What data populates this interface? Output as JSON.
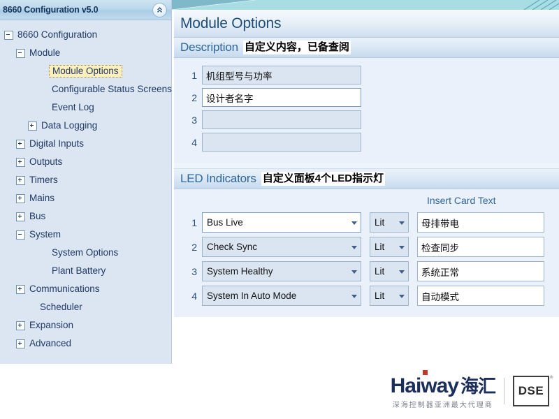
{
  "sidebar": {
    "title": "8660 Configuration v5.0",
    "collapse_icon": "chevron-double-up-icon",
    "tree": [
      {
        "label": "8660 Configuration",
        "indent": 0,
        "state": "expanded",
        "selected": false
      },
      {
        "label": "Module",
        "indent": 1,
        "state": "expanded",
        "selected": false
      },
      {
        "label": "Module Options",
        "indent": 3,
        "state": "leaf",
        "selected": true
      },
      {
        "label": "Configurable Status Screens",
        "indent": 3,
        "state": "leaf",
        "selected": false
      },
      {
        "label": "Event Log",
        "indent": 3,
        "state": "leaf",
        "selected": false
      },
      {
        "label": "Data Logging",
        "indent": 2,
        "state": "collapsed",
        "selected": false
      },
      {
        "label": "Digital Inputs",
        "indent": 1,
        "state": "collapsed",
        "selected": false
      },
      {
        "label": "Outputs",
        "indent": 1,
        "state": "collapsed",
        "selected": false
      },
      {
        "label": "Timers",
        "indent": 1,
        "state": "collapsed",
        "selected": false
      },
      {
        "label": "Mains",
        "indent": 1,
        "state": "collapsed",
        "selected": false
      },
      {
        "label": "Bus",
        "indent": 1,
        "state": "collapsed",
        "selected": false
      },
      {
        "label": "System",
        "indent": 1,
        "state": "expanded",
        "selected": false
      },
      {
        "label": "System Options",
        "indent": 3,
        "state": "leaf",
        "selected": false
      },
      {
        "label": "Plant Battery",
        "indent": 3,
        "state": "leaf",
        "selected": false
      },
      {
        "label": "Communications",
        "indent": 1,
        "state": "collapsed",
        "selected": false
      },
      {
        "label": "Scheduler",
        "indent": 2,
        "state": "leaf",
        "selected": false
      },
      {
        "label": "Expansion",
        "indent": 1,
        "state": "collapsed",
        "selected": false
      },
      {
        "label": "Advanced",
        "indent": 1,
        "state": "collapsed",
        "selected": false
      }
    ]
  },
  "page": {
    "title": "Module Options"
  },
  "description_section": {
    "title": "Description",
    "annotation": "自定义内容，已备查阅",
    "rows": [
      {
        "index": "1",
        "value": "机组型号与功率",
        "active": false
      },
      {
        "index": "2",
        "value": "设计者名字",
        "active": true
      },
      {
        "index": "3",
        "value": "",
        "active": false
      },
      {
        "index": "4",
        "value": "",
        "active": false
      }
    ]
  },
  "led_section": {
    "title": "LED Indicators",
    "annotation": "自定义面板4个LED指示灯",
    "card_text_header": "Insert Card Text",
    "rows": [
      {
        "index": "1",
        "source": "Bus Live",
        "mode": "Lit",
        "card_text": "母排带电",
        "active": true
      },
      {
        "index": "2",
        "source": "Check Sync",
        "mode": "Lit",
        "card_text": "检查同步",
        "active": false
      },
      {
        "index": "3",
        "source": "System Healthy",
        "mode": "Lit",
        "card_text": "系统正常",
        "active": false
      },
      {
        "index": "4",
        "source": "System In Auto Mode",
        "mode": "Lit",
        "card_text": "自动模式",
        "active": false
      }
    ]
  },
  "brand": {
    "name_en": "Haiway",
    "name_cn": "海汇",
    "tagline": "深海控制器亚洲最大代理商",
    "partner": "DSE",
    "trademark": "®"
  },
  "colors": {
    "accent_blue": "#1f4e79",
    "section_blue": "#2f6699",
    "tree_text": "#1f3864",
    "selection_yellow": "#fdf0bd",
    "panel_bg": "#eaf1fa",
    "sidebar_bg": "#dce6f2",
    "top_band_teal": "#a8dde3",
    "brand_navy": "#1b2d5b",
    "brand_red": "#c0392b"
  }
}
